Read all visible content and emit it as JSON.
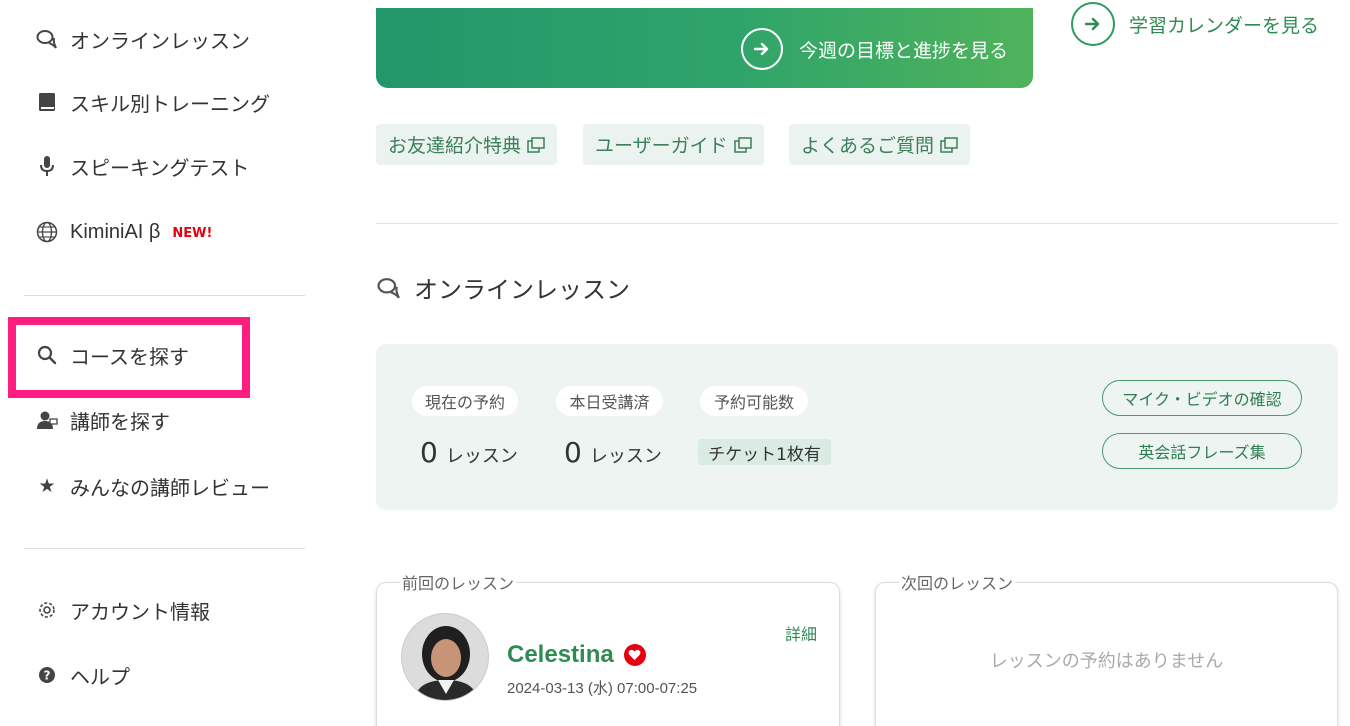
{
  "sidebar": {
    "items": [
      {
        "label": "オンラインレッスン",
        "icon": "chat-bubbles-icon"
      },
      {
        "label": "スキル別トレーニング",
        "icon": "book-icon"
      },
      {
        "label": "スピーキングテスト",
        "icon": "microphone-icon"
      },
      {
        "label": "KiminiAI β",
        "icon": "globe-icon",
        "badge": "NEW!"
      },
      {
        "label": "コースを探す",
        "icon": "search-icon"
      },
      {
        "label": "講師を探す",
        "icon": "teacher-icon"
      },
      {
        "label": "みんなの講師レビュー",
        "icon": "star-icon"
      },
      {
        "label": "アカウント情報",
        "icon": "gear-icon"
      },
      {
        "label": "ヘルプ",
        "icon": "help-icon"
      }
    ]
  },
  "banner": {
    "button_label": "今週の目標と進捗を見る"
  },
  "calendar_link": {
    "label": "学習カレンダーを見る"
  },
  "quick_links": [
    {
      "label": "お友達紹介特典"
    },
    {
      "label": "ユーザーガイド"
    },
    {
      "label": "よくあるご質問"
    }
  ],
  "lesson_section": {
    "title": "オンラインレッスン",
    "stats": {
      "reserved_label": "現在の予約",
      "reserved_value": "0",
      "reserved_unit": "レッスン",
      "today_label": "本日受講済",
      "today_value": "0",
      "today_unit": "レッスン",
      "available_label": "予約可能数",
      "available_value": "チケット1枚有"
    },
    "buttons": {
      "mic_check": "マイク・ビデオの確認",
      "phrases": "英会話フレーズ集"
    },
    "previous": {
      "legend": "前回のレッスン",
      "teacher": "Celestina",
      "datetime": "2024-03-13 (水) 07:00-07:25",
      "detail": "詳細"
    },
    "next": {
      "legend": "次回のレッスン",
      "empty": "レッスンの予約はありません"
    }
  },
  "colors": {
    "accent_green": "#2f8b54",
    "highlight_pink": "#ff1d7f",
    "new_red": "#e60012"
  }
}
